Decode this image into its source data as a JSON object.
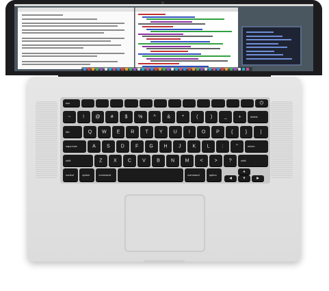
{
  "keyboard": {
    "rows": [
      [
        "esc",
        "",
        "",
        "",
        "",
        "",
        "",
        "",
        "",
        "",
        "",
        "",
        "",
        ""
      ],
      [
        "~",
        "!",
        "@",
        "#",
        "$",
        "%",
        "^",
        "&",
        "*",
        "(",
        ")",
        "_",
        "+",
        "delete"
      ],
      [
        "tab",
        "Q",
        "W",
        "E",
        "R",
        "T",
        "Y",
        "U",
        "I",
        "O",
        "P",
        "{",
        "}",
        "|"
      ],
      [
        "caps lock",
        "A",
        "S",
        "D",
        "F",
        "G",
        "H",
        "J",
        "K",
        "L",
        ":",
        "\"",
        "return"
      ],
      [
        "shift",
        "Z",
        "X",
        "C",
        "V",
        "B",
        "N",
        "M",
        "<",
        ">",
        "?",
        "shift"
      ],
      [
        "control",
        "option",
        "command",
        "",
        "command",
        "option"
      ]
    ]
  },
  "icons": {
    "power": "power-icon",
    "command": "command-icon",
    "arrows": [
      "arrow-left-icon",
      "arrow-up-icon",
      "arrow-down-icon",
      "arrow-right-icon"
    ]
  },
  "colors": {
    "keys": "#1b1b1b",
    "aluminum": "#e2e2e2",
    "bezel": "#1c1c1e"
  }
}
